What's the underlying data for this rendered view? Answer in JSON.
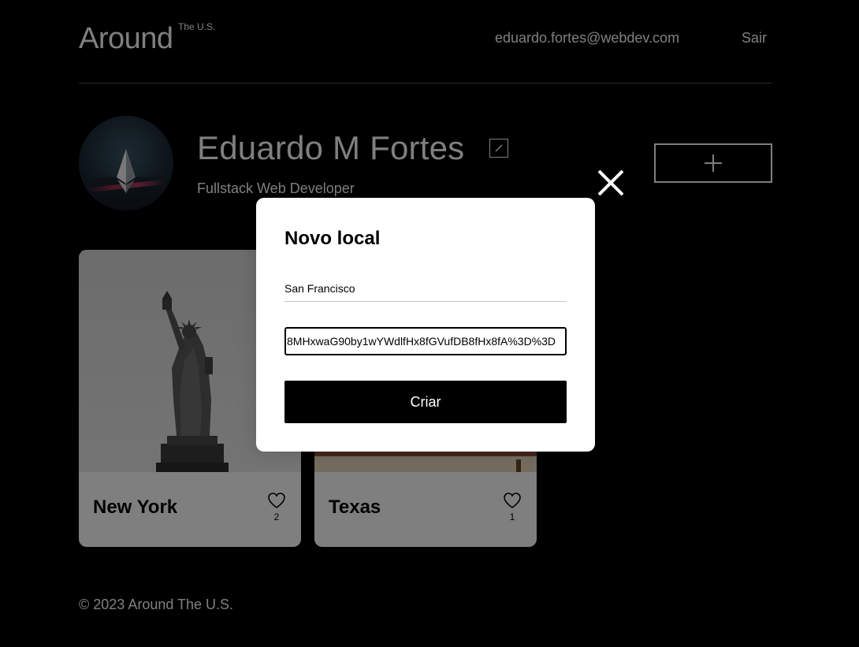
{
  "header": {
    "logo": "Around",
    "logo_sup": "The U.S.",
    "user_email": "eduardo.fortes@webdev.com",
    "logout_label": "Sair"
  },
  "profile": {
    "name": "Eduardo M Fortes",
    "role": "Fullstack Web Developer",
    "avatar_icon": "ethereum-avatar",
    "edit_icon": "pencil-icon",
    "add_icon": "plus-icon"
  },
  "cards": [
    {
      "title": "New York",
      "likes": "2",
      "image": "statue-of-liberty"
    },
    {
      "title": "Texas",
      "likes": "1",
      "image": "texas-landscape"
    }
  ],
  "footer": {
    "copyright": "© 2023 Around The U.S."
  },
  "modal": {
    "title": "Novo local",
    "name_value": "San Francisco",
    "link_value": "8MHxwaG90by1wYWdlfHx8fGVufDB8fHx8fA%3D%3D",
    "submit_label": "Criar",
    "close_icon": "close-icon"
  },
  "colors": {
    "background": "#000000",
    "modal_bg": "#ffffff",
    "button_bg": "#000000",
    "accent_glow": "#e04470"
  }
}
